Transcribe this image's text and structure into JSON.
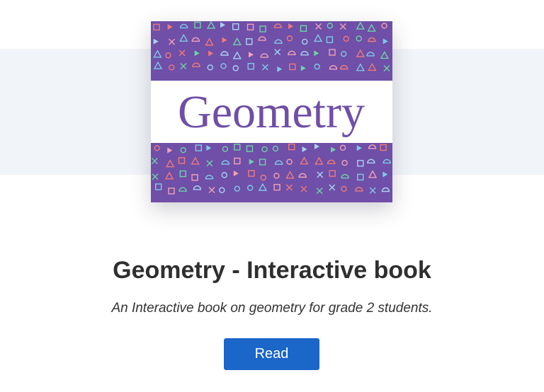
{
  "card": {
    "cover": {
      "title_text": "Geometry",
      "colors": {
        "background": "#6f4fa7",
        "text": "#6f4fa7",
        "band": "#ffffff",
        "shapes": [
          "#f07a7a",
          "#7fc9e8",
          "#6fd1a8",
          "#f2a3b5",
          "#a9d3f2"
        ]
      }
    },
    "title": "Geometry - Interactive book",
    "description": "An Interactive book on geometry for grade 2 students.",
    "read_button_label": "Read",
    "accent_color": "#1a66c9"
  }
}
